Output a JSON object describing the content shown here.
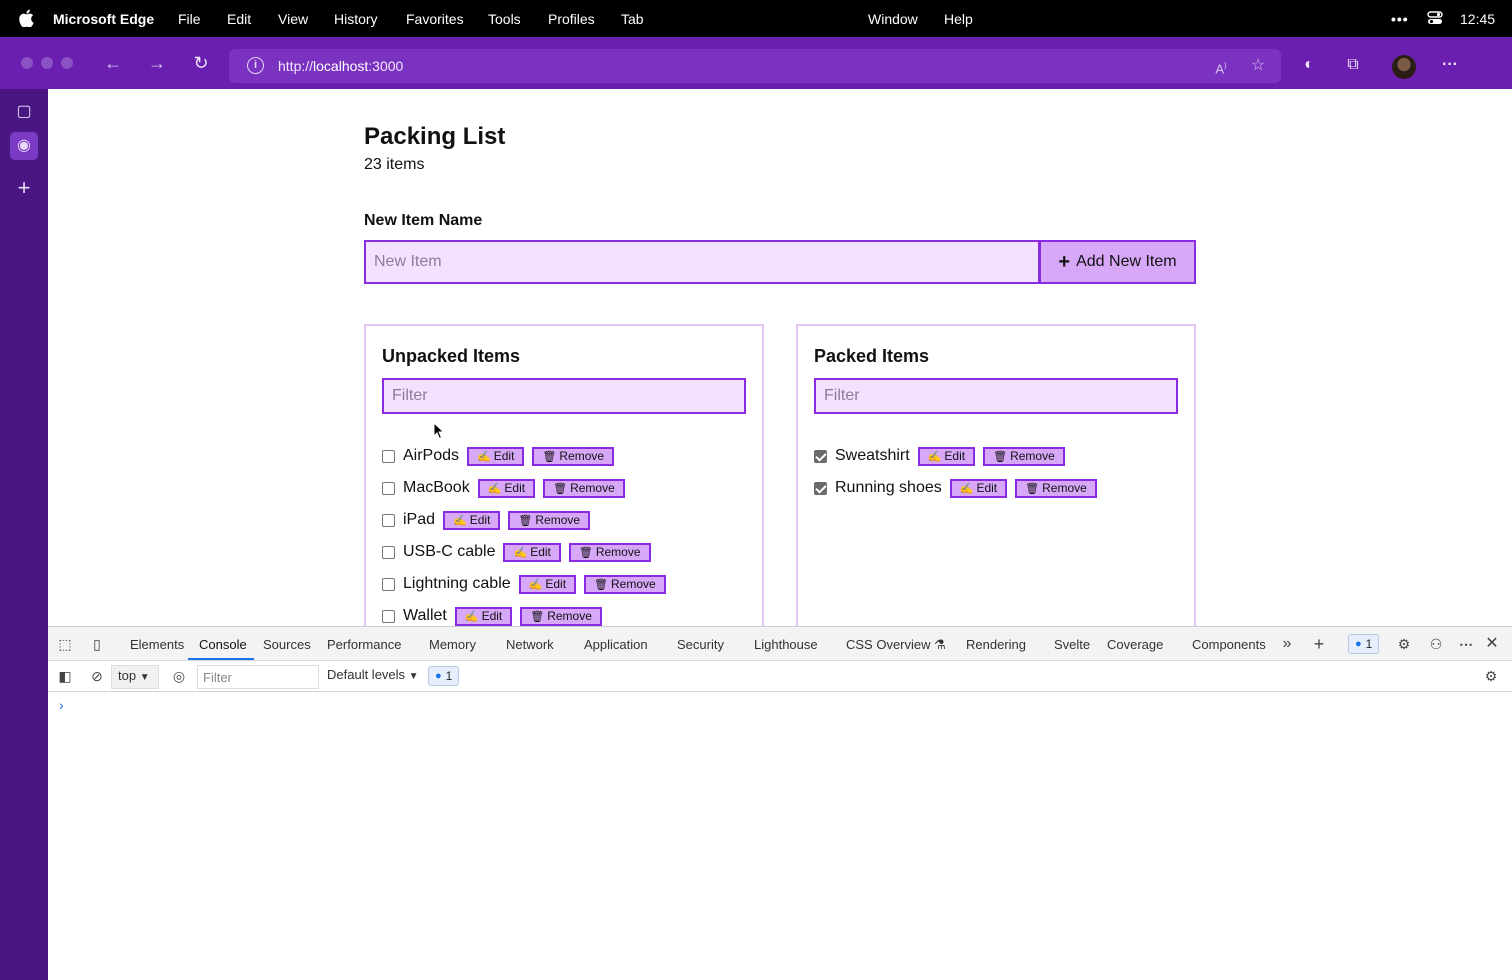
{
  "menubar": {
    "app_name": "Microsoft Edge",
    "items": [
      "File",
      "Edit",
      "View",
      "History",
      "Favorites",
      "Tools",
      "Profiles",
      "Tab",
      "Window",
      "Help"
    ],
    "clock": "12:45"
  },
  "browser": {
    "url_scheme": "http://",
    "url_host": "localhost",
    "url_port": ":3000"
  },
  "app": {
    "title": "Packing List",
    "count": "23 items",
    "new_item_label": "New Item Name",
    "new_item_placeholder": "New Item",
    "add_button": "Add New Item",
    "unpacked": {
      "heading": "Unpacked Items",
      "filter_placeholder": "Filter",
      "items": [
        {
          "name": "AirPods",
          "packed": false
        },
        {
          "name": "MacBook",
          "packed": false
        },
        {
          "name": "iPad",
          "packed": false
        },
        {
          "name": "USB-C cable",
          "packed": false
        },
        {
          "name": "Lightning cable",
          "packed": false
        },
        {
          "name": "Wallet",
          "packed": false
        }
      ]
    },
    "packed": {
      "heading": "Packed Items",
      "filter_placeholder": "Filter",
      "items": [
        {
          "name": "Sweatshirt",
          "packed": true
        },
        {
          "name": "Running shoes",
          "packed": true
        }
      ]
    },
    "edit_label": "Edit",
    "remove_label": "Remove"
  },
  "devtools": {
    "tabs": [
      "Elements",
      "Console",
      "Sources",
      "Performance",
      "Memory",
      "Network",
      "Application",
      "Security",
      "Lighthouse",
      "CSS Overview",
      "Rendering",
      "Svelte",
      "Coverage",
      "Components"
    ],
    "active_tab": "Console",
    "issues_count": "1",
    "context": "top",
    "filter_placeholder": "Filter",
    "levels": "Default levels",
    "messages_count": "1"
  },
  "colors": {
    "accent": "#8a2be2",
    "button_bg": "#d8a8f8",
    "input_bg": "#f3e2fd",
    "chrome": "#6a1fb0",
    "sidebar": "#4a1682"
  }
}
